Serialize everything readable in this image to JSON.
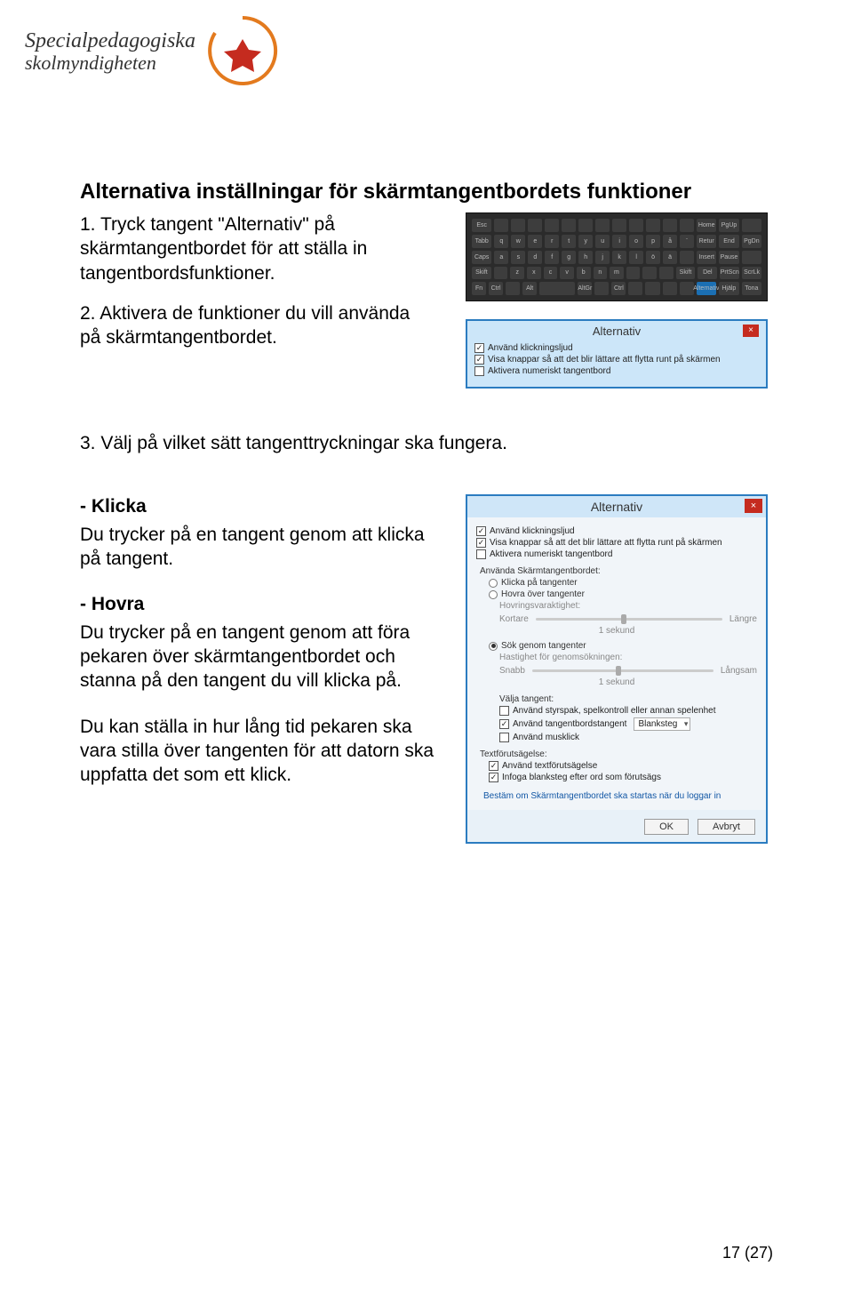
{
  "logo": {
    "line1": "Specialpedagogiska",
    "line2": "skolmyndigheten"
  },
  "title": "Alternativa inställningar för skärmtangentbordets funktioner",
  "steps": {
    "s1": "1. Tryck tangent \"Alternativ\" på skärmtangentbordet för att ställa in tangentbordsfunktioner.",
    "s2": "2. Aktivera de funktioner du vill använda på skärmtangentbordet.",
    "s3": "3. Välj på vilket sätt tangenttryckningar ska fungera."
  },
  "klicka": {
    "h": "- Klicka",
    "p": "Du trycker på en tangent genom att klicka på tangent."
  },
  "hovra": {
    "h": "- Hovra",
    "p1": "Du trycker på en tangent genom att föra pekaren över skärmtangentbordet och stanna på den tangent du vill klicka på.",
    "p2": "Du kan ställa in hur lång tid pekaren ska vara stilla över tangenten för att datorn ska uppfatta det som ett klick."
  },
  "alt_small": {
    "title": "Alternativ",
    "opt1": "Använd klickningsljud",
    "opt2": "Visa knappar så att det blir lättare att flytta runt på skärmen",
    "opt3": "Aktivera numeriskt tangentbord"
  },
  "alt_big": {
    "title": "Alternativ",
    "opt1": "Använd klickningsljud",
    "opt2": "Visa knappar så att det blir lättare att flytta runt på skärmen",
    "opt3": "Aktivera numeriskt tangentbord",
    "sec_use": "Använda Skärmtangentbordet:",
    "r_click": "Klicka på tangenter",
    "r_hover": "Hovra över tangenter",
    "hover_dur_label": "Hovringsvaraktighet:",
    "short": "Kortare",
    "long": "Längre",
    "one_sec": "1 sekund",
    "r_scan": "Sök genom tangenter",
    "scan_speed_label": "Hastighet för genomsökningen:",
    "fast": "Snabb",
    "slow": "Långsam",
    "sec_select": "Välja tangent:",
    "cb_joy": "Använd styrspak, spelkontroll eller annan spelenhet",
    "cb_kb": "Använd tangentbordstangent",
    "kb_sel": "Blanksteg",
    "cb_mouse": "Använd musklick",
    "sec_pred": "Textförutsägelse:",
    "cb_pred": "Använd textförutsägelse",
    "cb_space": "Infoga blanksteg efter ord som förutsägs",
    "link": "Bestäm om Skärmtangentbordet ska startas när du loggar in",
    "ok": "OK",
    "cancel": "Avbryt"
  },
  "kb_labels": {
    "row0": [
      "Esc",
      "",
      "",
      "",
      "",
      "",
      "",
      "",
      "",
      "",
      "",
      "",
      "",
      "Home",
      "PgUp",
      ""
    ],
    "row1": [
      "Tabb",
      "q",
      "w",
      "e",
      "r",
      "t",
      "y",
      "u",
      "i",
      "o",
      "p",
      "å",
      "¨",
      "Retur",
      "End",
      "PgDn",
      ""
    ],
    "row2": [
      "Caps",
      "a",
      "s",
      "d",
      "f",
      "g",
      "h",
      "j",
      "k",
      "l",
      "ö",
      "ä",
      "",
      "Insert",
      "Pause",
      ""
    ],
    "row3": [
      "Skift",
      "",
      "z",
      "x",
      "c",
      "v",
      "b",
      "n",
      "m",
      "",
      ",",
      ".",
      "Skift",
      "Del",
      "PrtScn",
      "ScrLk",
      ""
    ],
    "row4": [
      "Fn",
      "Ctrl",
      "",
      "Alt",
      "",
      "AltGr",
      "",
      "Ctrl",
      "",
      "",
      "",
      "",
      "",
      "Alternativ",
      "Hjälp",
      "Tona"
    ]
  },
  "page_num": "17 (27)"
}
